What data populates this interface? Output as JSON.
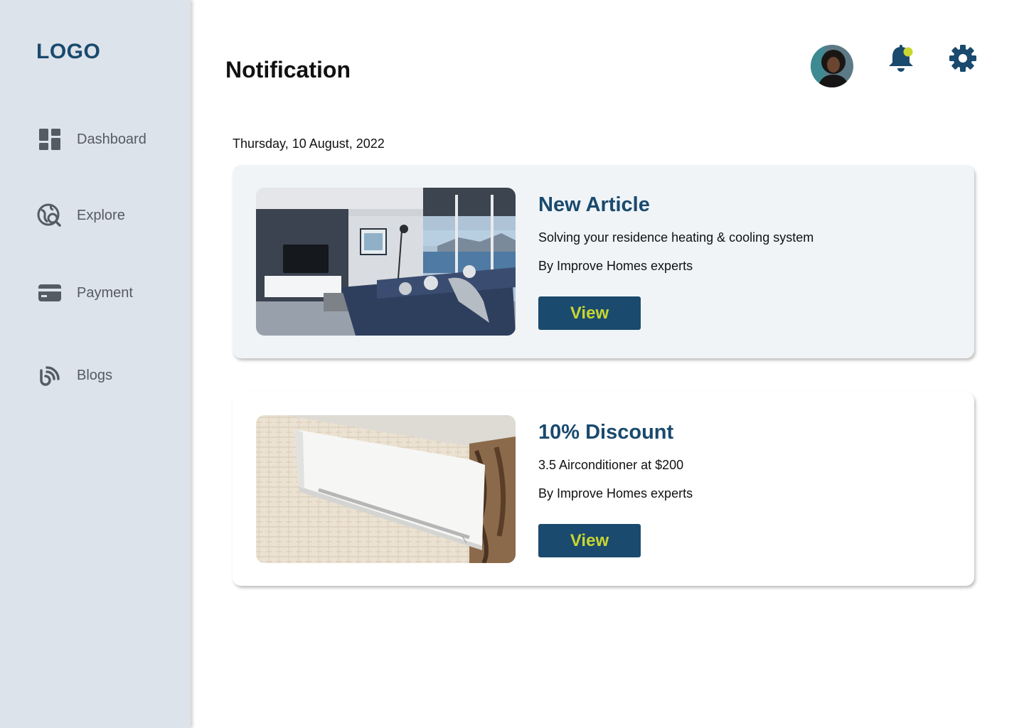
{
  "sidebar": {
    "logo": "LOGO",
    "items": [
      {
        "label": "Dashboard",
        "icon": "dashboard-icon"
      },
      {
        "label": "Explore",
        "icon": "explore-icon"
      },
      {
        "label": "Payment",
        "icon": "payment-card-icon"
      },
      {
        "label": "Blogs",
        "icon": "blog-icon"
      }
    ]
  },
  "header": {
    "title": "Notification",
    "avatar": "user-avatar",
    "bell": "bell-icon",
    "settings": "gear-icon"
  },
  "colors": {
    "primary": "#1a4a6e",
    "accent": "#c8d630",
    "sidebar_bg": "#dde3ea",
    "card_highlight_bg": "#f0f4f7"
  },
  "main": {
    "date": "Thursday, 10 August, 2022",
    "notifications": [
      {
        "title": "New Article",
        "description": "Solving your residence heating & cooling system",
        "author": "By Improve Homes experts",
        "button": "View",
        "image": "living-room-photo"
      },
      {
        "title": "10% Discount",
        "description": "3.5 Airconditioner at $200",
        "author": "By Improve Homes experts",
        "button": "View",
        "image": "air-conditioner-photo"
      }
    ]
  }
}
